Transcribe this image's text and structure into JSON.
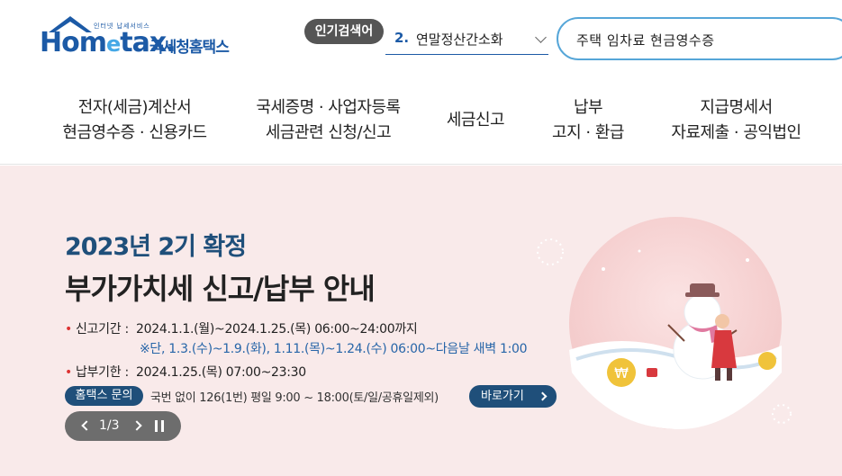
{
  "header": {
    "logo_small": "인터넷 납세서비스",
    "logo_main": "Hometax",
    "logo_korean": "국세청홈택스",
    "popular_badge": "인기검색어",
    "popular_rank": "2.",
    "popular_term": "연말정산간소화",
    "search_value": "주택 임차료 현금영수증"
  },
  "nav": [
    {
      "line1": "전자(세금)계산서",
      "line2": "현금영수증 · 신용카드"
    },
    {
      "line1": "국세증명 · 사업자등록",
      "line2": "세금관련 신청/신고"
    },
    {
      "line1": "세금신고",
      "line2": ""
    },
    {
      "line1": "납부",
      "line2": "고지 · 환급"
    },
    {
      "line1": "지급명세서",
      "line2": "자료제출 · 공익법인"
    }
  ],
  "banner": {
    "title1": "2023년 2기 확정",
    "title2": "부가가치세 신고/납부 안내",
    "filing_label": "신고기간 :",
    "filing_value": "2024.1.1.(월)~2024.1.25.(목) 06:00~24:00까지",
    "filing_note": "※단, 1.3.(수)~1.9.(화), 1.11.(목)~1.24.(수) 06:00~다음날 새벽 1:00",
    "payment_label": "납부기한 :",
    "payment_value": "2024.1.25.(목) 07:00~23:30",
    "inquiry_badge": "홈택스 문의",
    "inquiry_text": "국번 없이 126(1번) 평일 9:00 ~ 18:00(토/일/공휴일제외)",
    "goto_label": "바로가기",
    "pager": "1/3"
  },
  "colors": {
    "brand_blue": "#1c5aa6",
    "banner_bg": "#f9eaea",
    "navy": "#1f4f7a",
    "search_border": "#56a6d8"
  }
}
